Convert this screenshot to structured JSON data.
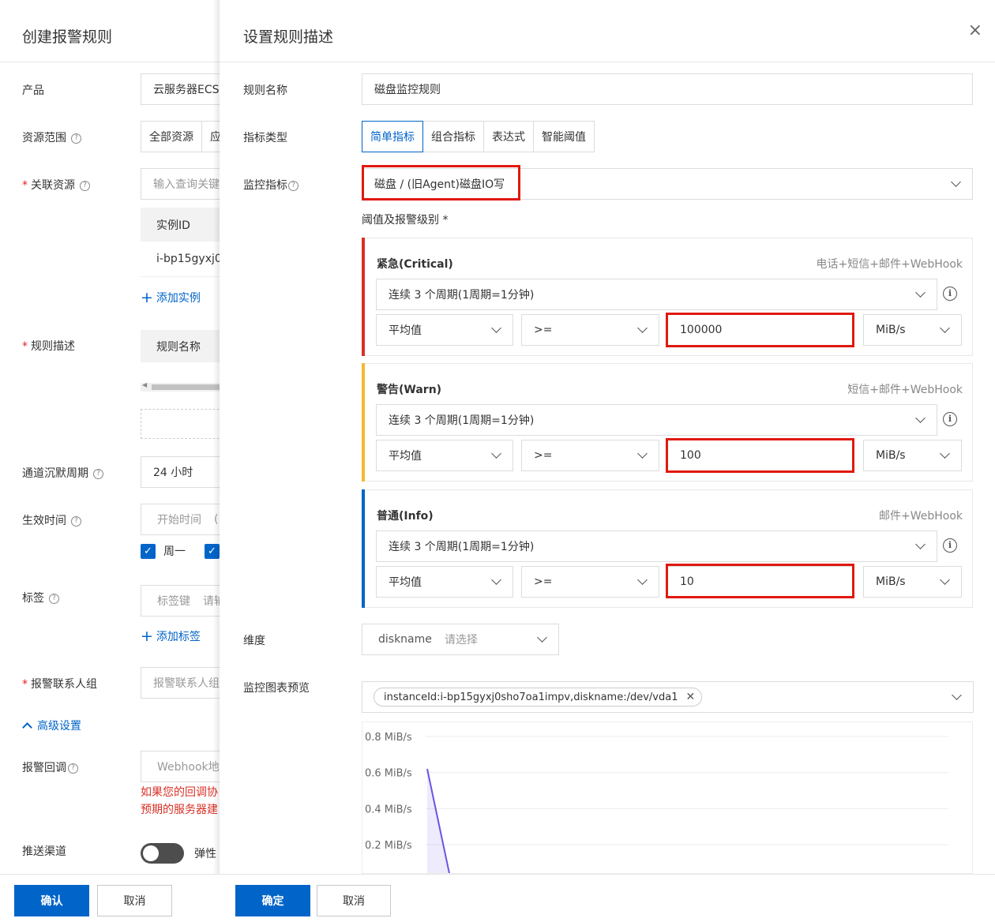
{
  "back": {
    "title": "创建报警规则",
    "product_label": "产品",
    "product_value": "云服务器ECS",
    "scope_label": "资源范围",
    "scope_opt1": "全部资源",
    "scope_opt2": "应",
    "assoc_label": "关联资源",
    "assoc_placeholder": "输入查询关键",
    "instance_header": "实例ID",
    "instance_value": "i-bp15gyxj0",
    "add_instance": "添加实例",
    "rule_desc_label": "规则描述",
    "rule_name_col": "规则名称",
    "silence_label": "通道沉默周期",
    "silence_value": "24 小时",
    "effective_label": "生效时间",
    "start_time": "开始时间",
    "start_time_sep": "(",
    "monday": "周一",
    "tags_label": "标签",
    "tag_key": "标签键",
    "tag_value": "请输",
    "add_tag": "添加标签",
    "contact_label": "报警联系人组",
    "contact_placeholder": "报警联系人组",
    "advanced": "高级设置",
    "callback_label": "报警回调",
    "callback_placeholder": "Webhook地",
    "callback_warn1": "如果您的回调协",
    "callback_warn2": "预期的服务器建",
    "push_label": "推送渠道",
    "push_text": "弹性"
  },
  "panel": {
    "title": "设置规则描述",
    "close": "×",
    "rule_name_label": "规则名称",
    "rule_name_value": "磁盘监控规则",
    "metric_type_label": "指标类型",
    "metric_types": [
      "简单指标",
      "组合指标",
      "表达式",
      "智能阈值"
    ],
    "metric_label": "监控指标",
    "metric_value": "磁盘 / (旧Agent)磁盘IO写",
    "threshold_label": "阈值及报警级别 *",
    "levels": [
      {
        "title": "紧急(Critical)",
        "note": "电话+短信+邮件+WebHook",
        "color": "#d93026",
        "period": "连续 3 个周期(1周期=1分钟)",
        "stat": "平均值",
        "op": ">=",
        "value": "100000",
        "unit": "MiB/s"
      },
      {
        "title": "警告(Warn)",
        "note": "短信+邮件+WebHook",
        "color": "#f5b82e",
        "period": "连续 3 个周期(1周期=1分钟)",
        "stat": "平均值",
        "op": ">=",
        "value": "100",
        "unit": "MiB/s"
      },
      {
        "title": "普通(Info)",
        "note": "邮件+WebHook",
        "color": "#0064c8",
        "period": "连续 3 个周期(1周期=1分钟)",
        "stat": "平均值",
        "op": ">=",
        "value": "10",
        "unit": "MiB/s"
      }
    ],
    "dimension_label": "维度",
    "dimension_key": "diskname",
    "dimension_placeholder": "请选择",
    "preview_label": "监控图表预览",
    "preview_tag": "instanceId:i-bp15gyxj0sho7oa1impv,diskname:/dev/vda1"
  },
  "chart_data": {
    "type": "line",
    "y_ticks": [
      "0.8 MiB/s",
      "0.6 MiB/s",
      "0.4 MiB/s",
      "0.2 MiB/s"
    ],
    "series": [
      {
        "values": [
          0.62,
          0.0
        ]
      }
    ],
    "ylim": [
      0,
      0.8
    ],
    "grid": true
  },
  "footer": {
    "back_ok": "确认",
    "back_cancel": "取消",
    "ok": "确定",
    "cancel": "取消"
  },
  "colors": {
    "primary": "#0064c8",
    "critical": "#d93026",
    "warn": "#f5b82e",
    "highlight": "#e0190f"
  }
}
